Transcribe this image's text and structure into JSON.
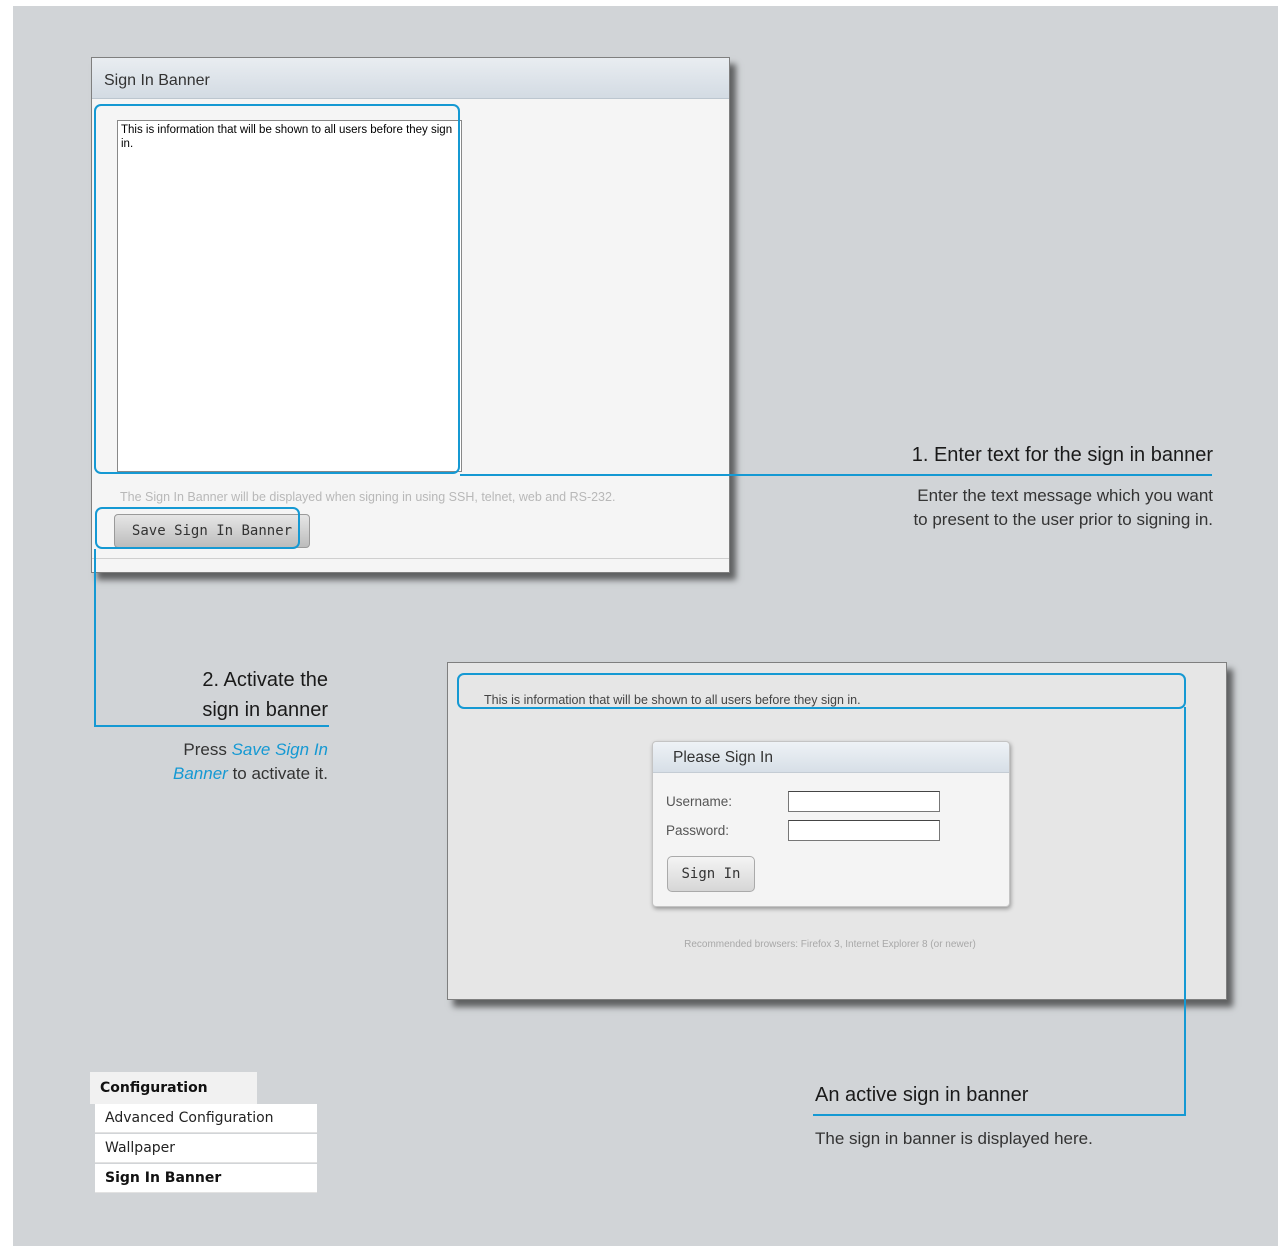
{
  "banner_editor": {
    "title": "Sign In Banner",
    "textarea_value": "This is information that will be shown to all users before they sign in.",
    "note": "The Sign In Banner will be displayed when signing in using SSH, telnet, web and RS-232.",
    "save_button": "Save Sign In Banner"
  },
  "callout_1": {
    "title": "1. Enter text for the sign in banner",
    "desc_line1": "Enter the text message which you want",
    "desc_line2": "to present to the user prior to signing in."
  },
  "callout_2": {
    "title_line1": "2. Activate the",
    "title_line2": "sign in banner",
    "desc_press": "Press",
    "desc_link_1": "Save Sign In",
    "desc_link_2": "Banner",
    "desc_end": "to activate it."
  },
  "login_page": {
    "banner_text": "This is information that will be shown to all users before they sign in.",
    "box_title": "Please Sign In",
    "username_label": "Username:",
    "password_label": "Password:",
    "username_value": "",
    "password_value": "",
    "signin_button": "Sign In",
    "recommended": "Recommended browsers: Firefox 3, Internet Explorer 8 (or newer)"
  },
  "callout_3": {
    "title": "An active sign in banner",
    "desc": "The sign in banner is displayed here."
  },
  "config_menu": {
    "header": "Configuration",
    "items": [
      "Advanced Configuration",
      "Wallpaper",
      "Sign In Banner"
    ],
    "active_item": "Sign In Banner"
  },
  "colors": {
    "accent": "#1599d3",
    "background": "#d1d4d7"
  }
}
